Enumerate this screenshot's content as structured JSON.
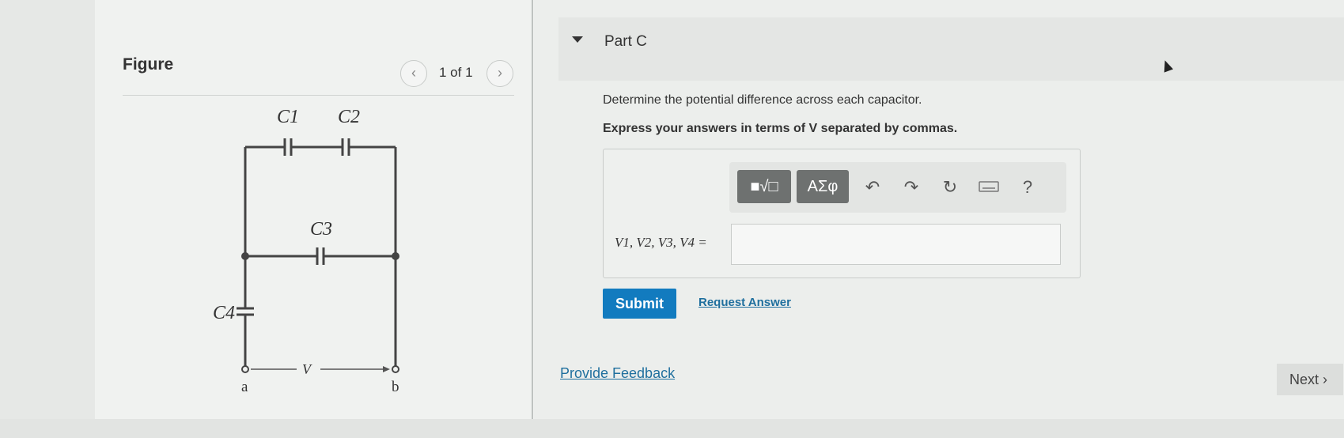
{
  "figure": {
    "title": "Figure",
    "page_count": "1 of 1",
    "prev_icon": "chevron-left-icon",
    "next_icon": "chevron-right-icon",
    "circuit": {
      "labels": {
        "c1": "C1",
        "c2": "C2",
        "c3": "C3",
        "c4": "C4",
        "v": "V",
        "a": "a",
        "b": "b"
      }
    }
  },
  "part": {
    "title": "Part C",
    "question": "Determine the potential difference across each capacitor.",
    "instruction": "Express your answers in terms of V separated by commas."
  },
  "toolbar": {
    "template_icon": "template-fraction-root-icon",
    "greek_label": "ΑΣφ",
    "undo_icon": "undo-icon",
    "redo_icon": "redo-icon",
    "reset_icon": "reset-icon",
    "keyboard_icon": "keyboard-icon",
    "help_label": "?"
  },
  "answer": {
    "label": "V1, V2, V3, V4 =",
    "value": ""
  },
  "actions": {
    "submit_label": "Submit",
    "request_answer_label": "Request Answer",
    "provide_feedback_label": "Provide Feedback",
    "next_label": "Next"
  },
  "colors": {
    "submit": "#127bbf",
    "link": "#1f6f9e",
    "toolbar_dark": "#6e7170"
  }
}
